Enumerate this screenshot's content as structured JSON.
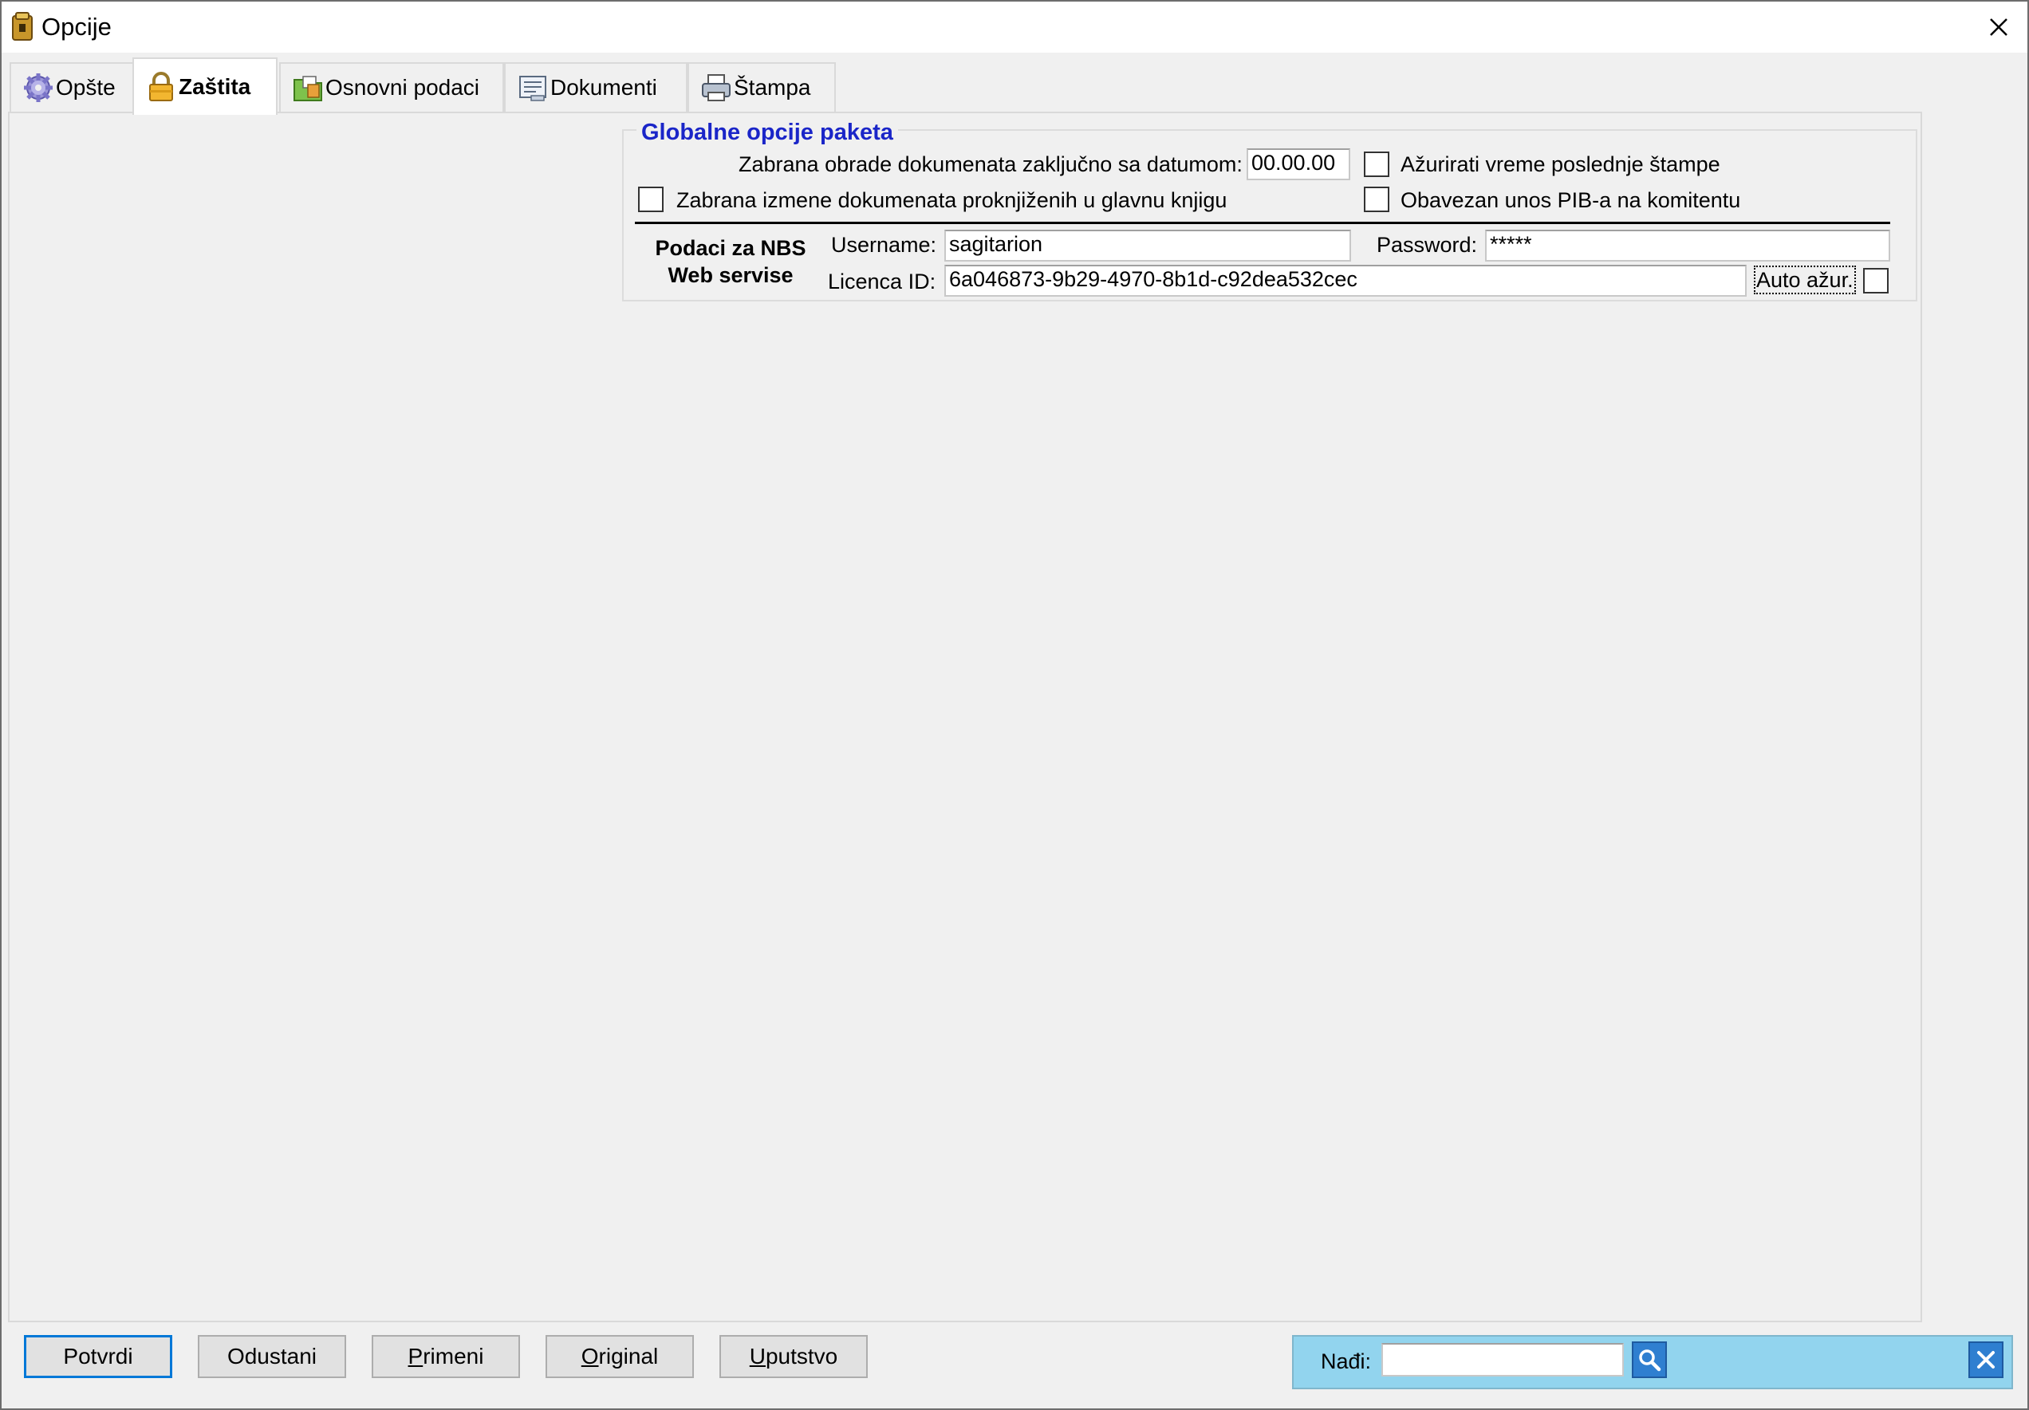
{
  "window": {
    "title": "Opcije"
  },
  "tabs": [
    {
      "label": "Opšte",
      "icon": "gear-icon"
    },
    {
      "label": "Zaštita",
      "icon": "lock-icon",
      "active": true
    },
    {
      "label": "Osnovni podaci",
      "icon": "folder-icon"
    },
    {
      "label": "Dokumenti",
      "icon": "document-icon"
    },
    {
      "label": "Štampa",
      "icon": "printer-icon"
    }
  ],
  "global_options": {
    "title": "Globalne opcije paketa",
    "lock_date_label": "Zabrana obrade dokumenata zaključno sa datumom:",
    "lock_date_value": "00.00.00",
    "update_print_time_label": "Ažurirati vreme poslednje štampe",
    "update_print_time_checked": false,
    "forbid_edit_posted_label": "Zabrana izmene dokumenata proknjiženih u glavnu knjigu",
    "forbid_edit_posted_checked": false,
    "require_pib_label": "Obavezan unos PIB-a na komitentu",
    "require_pib_checked": false
  },
  "nbs": {
    "heading_line1": "Podaci za NBS",
    "heading_line2": "Web servise",
    "username_label": "Username:",
    "username_value": "sagitarion",
    "password_label": "Password:",
    "password_value": "*****",
    "license_label": "Licenca ID:",
    "license_value": "6a046873-9b29-4970-8b1d-c92dea532cec",
    "auto_update_label": "Auto ažur.",
    "auto_update_checked": false
  },
  "buttons": {
    "confirm": "Potvrdi",
    "cancel": "Odustani",
    "apply_rest": "rimeni",
    "apply_mnemonic": "P",
    "original_rest": "riginal",
    "original_mnemonic": "O",
    "help_rest": "putstvo",
    "help_mnemonic": "U"
  },
  "find": {
    "label": "Nađi:",
    "value": ""
  },
  "colors": {
    "group_title": "#1a25c8",
    "find_panel": "#92d4ee",
    "default_button_border": "#0078d7"
  }
}
